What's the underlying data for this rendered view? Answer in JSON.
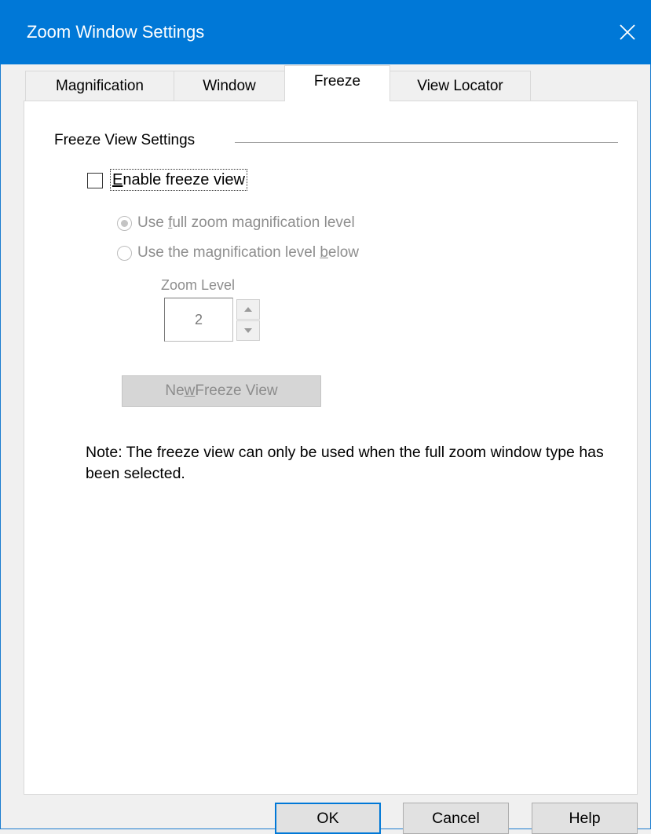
{
  "window": {
    "title": "Zoom Window Settings",
    "close_icon": "close-icon"
  },
  "tabs": [
    {
      "label": "Magnification",
      "selected": false
    },
    {
      "label": "Window",
      "selected": false
    },
    {
      "label": "Freeze",
      "selected": true
    },
    {
      "label": "View Locator",
      "selected": false
    }
  ],
  "freeze": {
    "group_label": "Freeze View Settings",
    "enable_checkbox": {
      "label_prefix": "E",
      "label_rest": "nable freeze view",
      "checked": false
    },
    "radio_full": {
      "label_pre": "Use ",
      "label_u": "f",
      "label_post": "ull zoom magnification level",
      "checked": true,
      "enabled": false
    },
    "radio_below": {
      "label_pre": "Use the magnification level ",
      "label_u": "b",
      "label_post": "elow",
      "checked": false,
      "enabled": false
    },
    "zoom_level_label": "Zoom Level",
    "zoom_level_value": "2",
    "new_freeze_button": {
      "label_pre": "Ne",
      "label_u": "w",
      "label_post": " Freeze View",
      "enabled": false
    },
    "note": "Note: The freeze view can only be used when the full zoom window type has been selected."
  },
  "buttons": {
    "ok": "OK",
    "cancel": "Cancel",
    "help": "Help"
  },
  "colors": {
    "titlebar": "#0078d7",
    "default_button_border": "#0078d7"
  }
}
